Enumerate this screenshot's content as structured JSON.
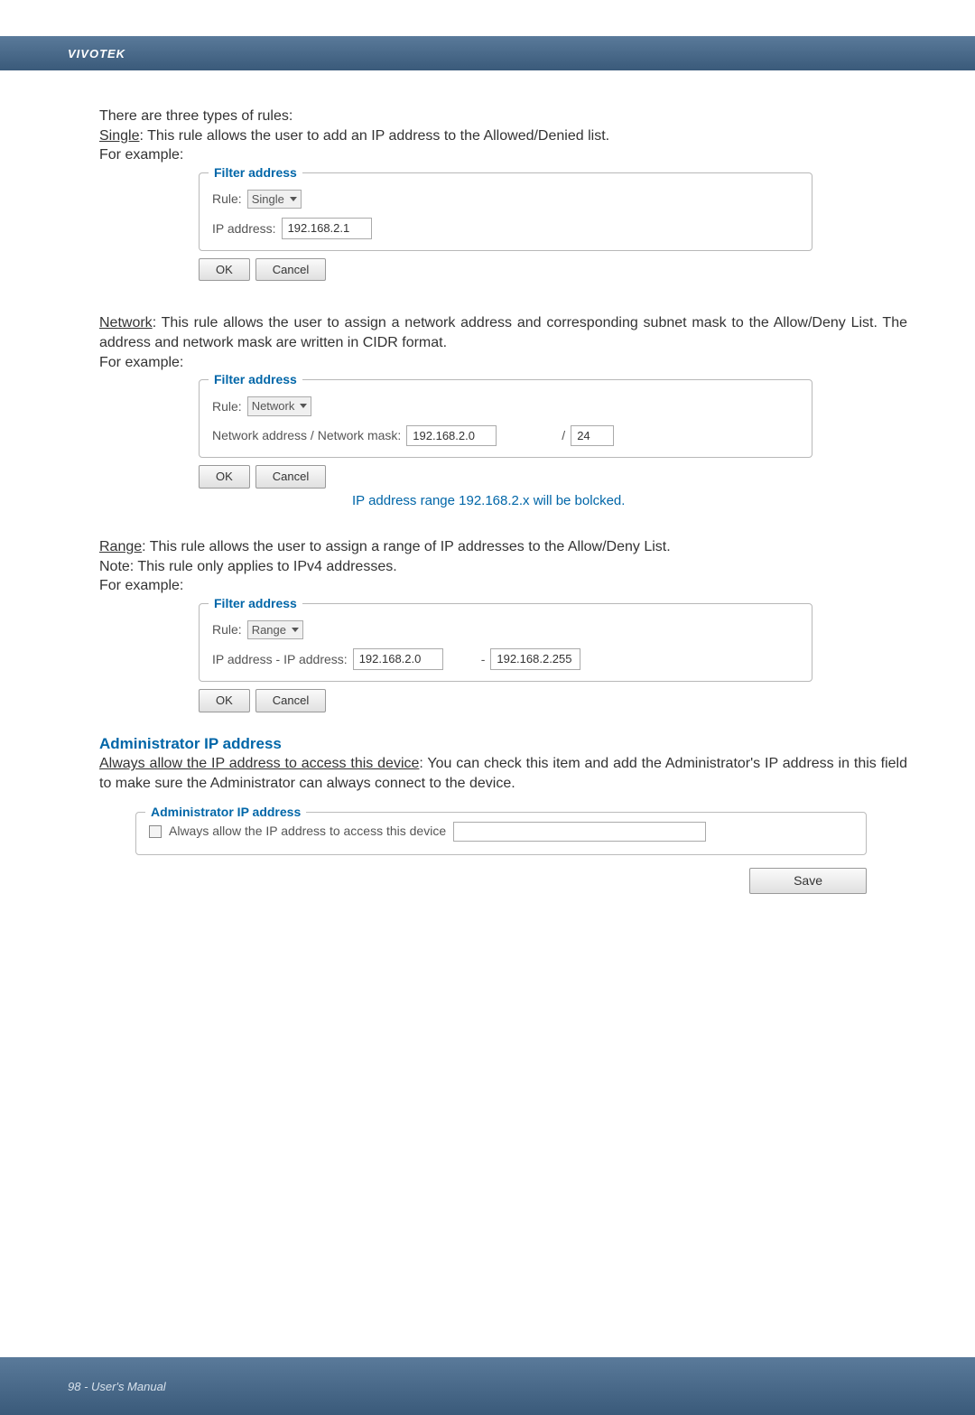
{
  "header": {
    "brand": "VIVOTEK"
  },
  "intro": {
    "line1": "There are three types of rules:",
    "single_label": "Single",
    "single_desc": ": This rule allows the user to add an IP address to the Allowed/Denied list.",
    "for_example": "For example:"
  },
  "fs_single": {
    "legend": "Filter address",
    "rule_label": "Rule:",
    "rule_value": "Single",
    "ip_label": "IP address:",
    "ip_value": "192.168.2.1",
    "ok": "OK",
    "cancel": "Cancel"
  },
  "network": {
    "label": "Network",
    "desc": ": This rule allows the user to assign a network address and corresponding subnet mask to the Allow/Deny List. The address and network mask are written in CIDR format.",
    "for_example": "For example:"
  },
  "fs_network": {
    "legend": "Filter address",
    "rule_label": "Rule:",
    "rule_value": "Network",
    "addr_label": "Network address / Network mask:",
    "addr_value": "192.168.2.0",
    "slash": "/",
    "mask_value": "24",
    "ok": "OK",
    "cancel": "Cancel"
  },
  "blue_note": "IP address range 192.168.2.x will be bolcked.",
  "range": {
    "label": "Range",
    "desc": ": This rule allows the user to assign a range of IP addresses to the Allow/Deny List.",
    "note": "Note: This rule only applies to IPv4 addresses.",
    "for_example": "For example:"
  },
  "fs_range": {
    "legend": "Filter address",
    "rule_label": "Rule:",
    "rule_value": "Range",
    "addr_label": "IP address - IP address:",
    "from_value": "192.168.2.0",
    "dash": "-",
    "to_value": "192.168.2.255",
    "ok": "OK",
    "cancel": "Cancel"
  },
  "admin": {
    "title": "Administrator IP address",
    "always_label": "Always allow the IP address to access this device",
    "desc": ": You can check this item and add the Administrator's IP address in this field to make sure the Administrator can always connect to the device.",
    "legend": "Administrator IP address",
    "checkbox_label": "Always allow the IP address to access this device",
    "save": "Save"
  },
  "footer": {
    "text": "98 - User's Manual"
  }
}
